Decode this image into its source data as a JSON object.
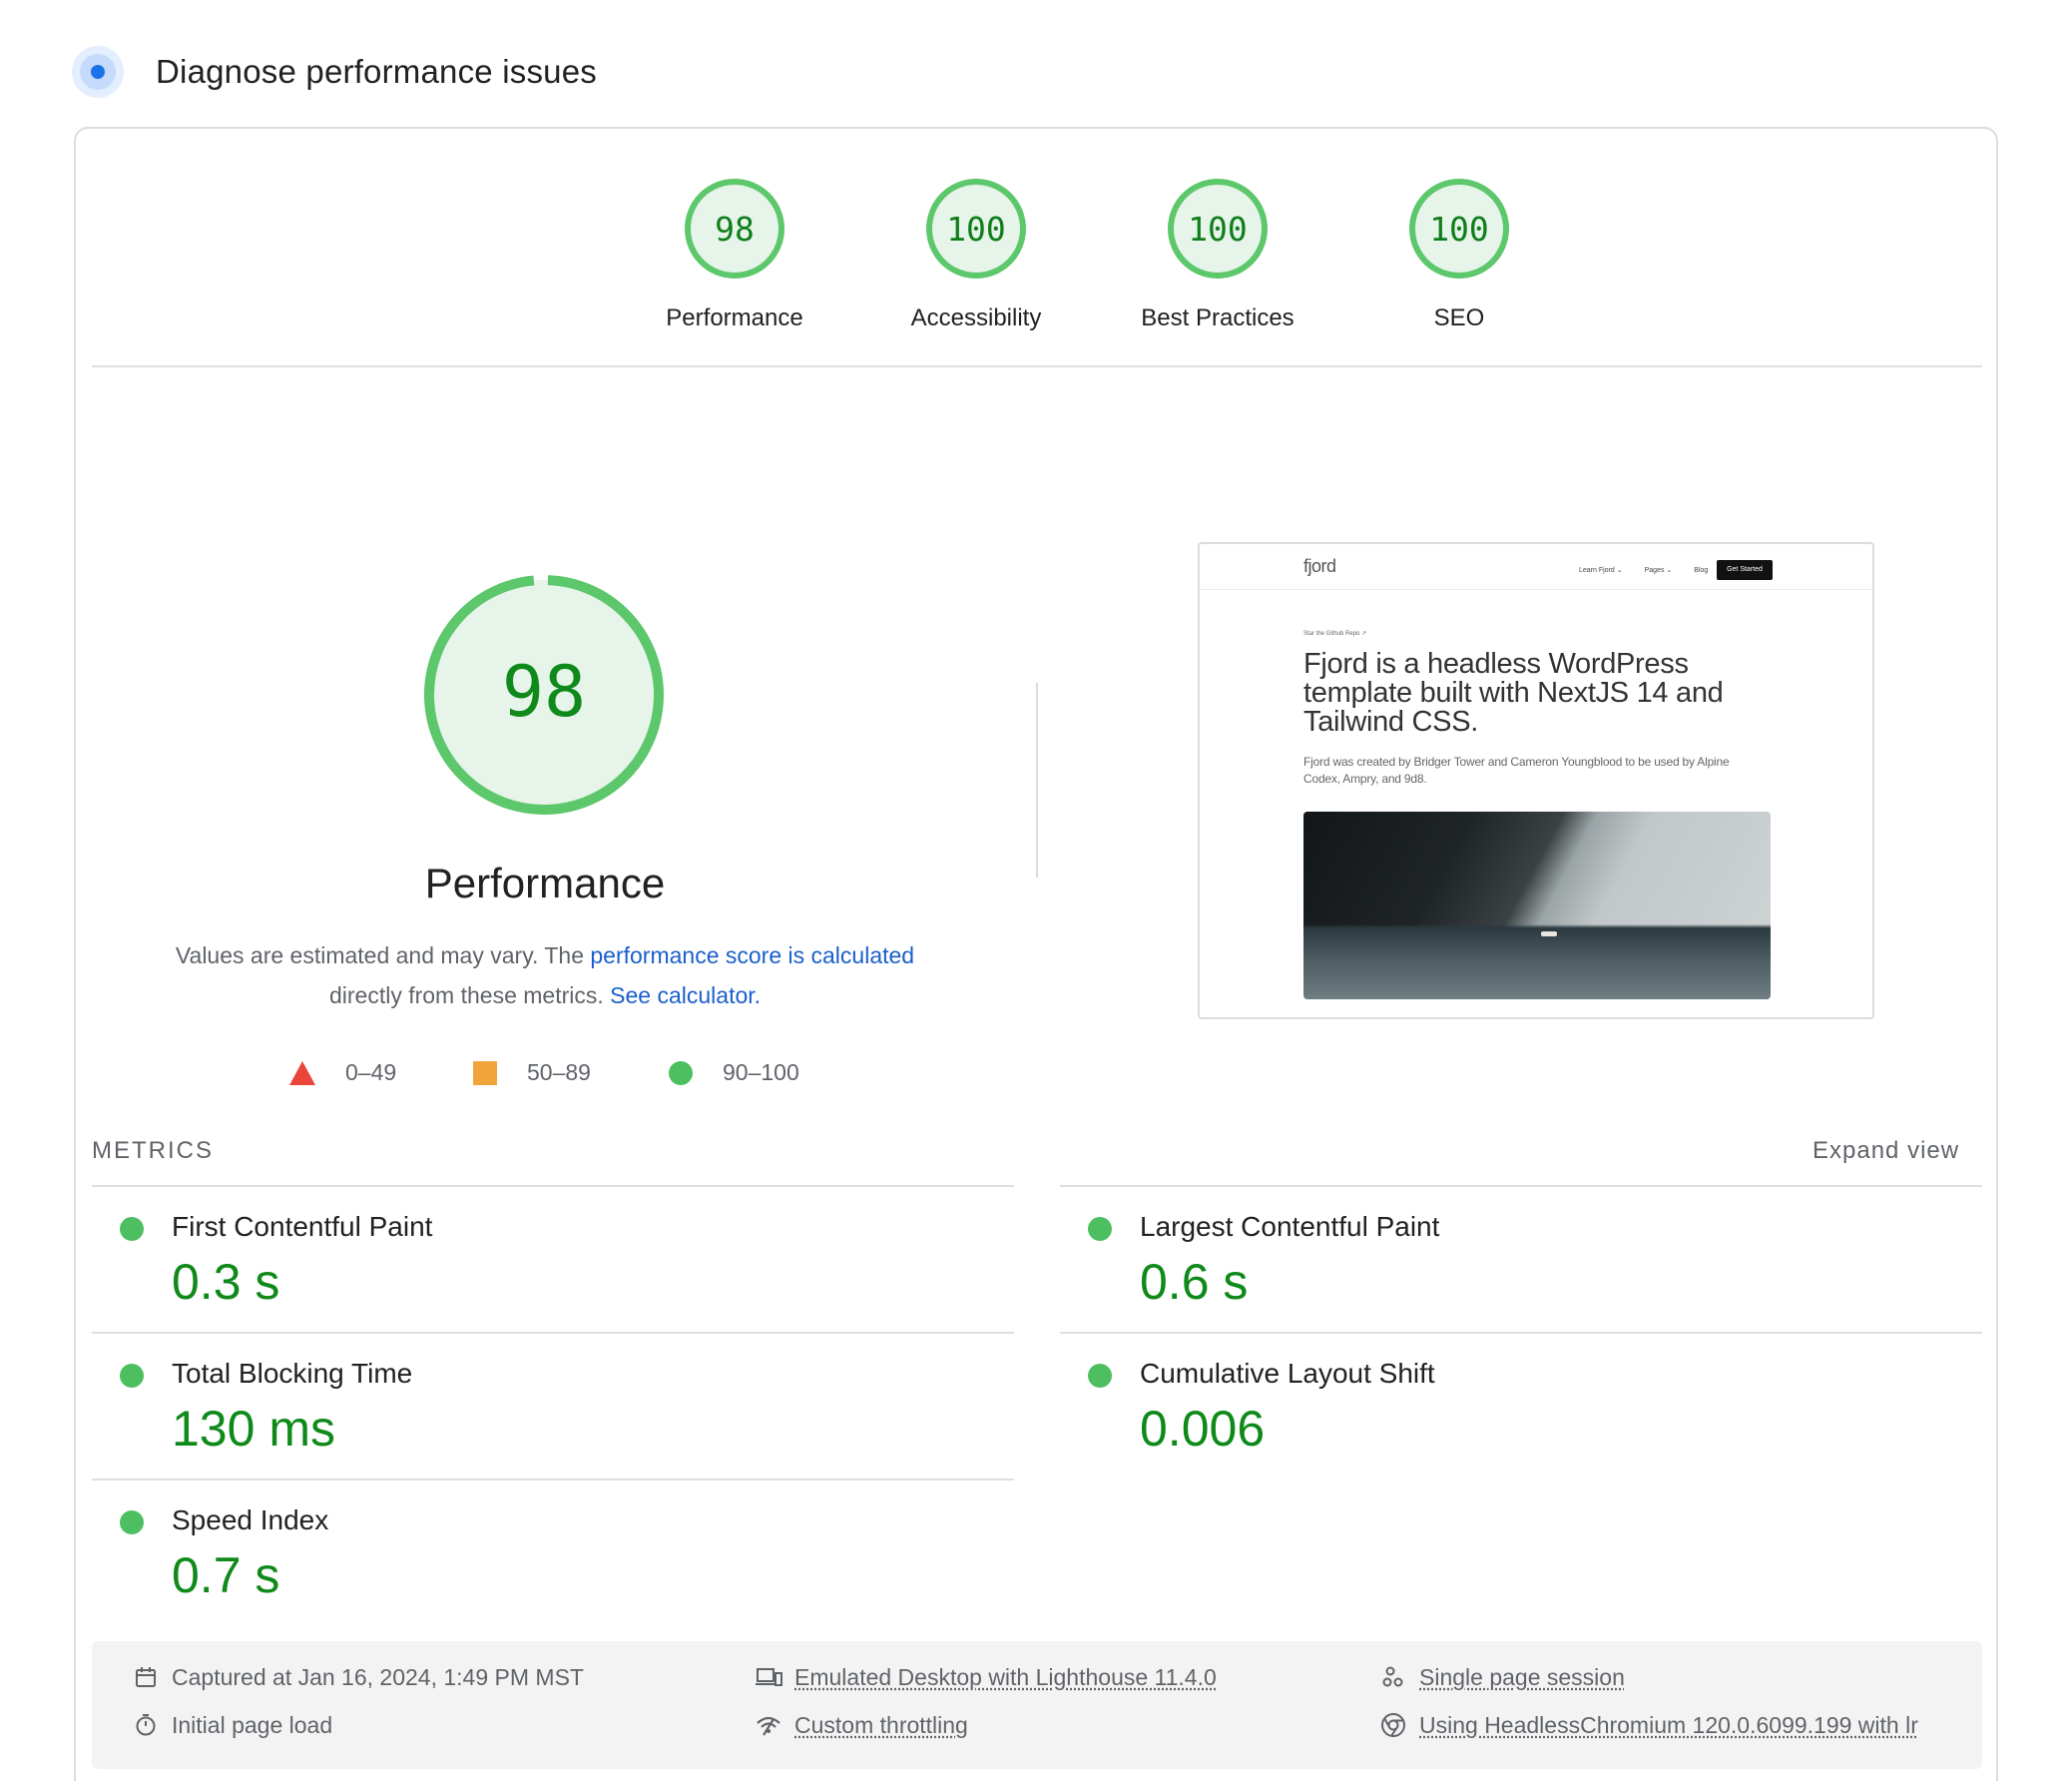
{
  "header": {
    "title": "Diagnose performance issues"
  },
  "categories": [
    {
      "score": "98",
      "label": "Performance"
    },
    {
      "score": "100",
      "label": "Accessibility"
    },
    {
      "score": "100",
      "label": "Best Practices"
    },
    {
      "score": "100",
      "label": "SEO"
    }
  ],
  "performance": {
    "score": "98",
    "score_fraction": 0.98,
    "title": "Performance",
    "desc_prefix": "Values are estimated and may vary. The ",
    "desc_link1": "performance score is calculated",
    "desc_mid": "directly from these metrics. ",
    "desc_link2": "See calculator.",
    "legend": {
      "fail": "0–49",
      "average": "50–89",
      "pass": "90–100"
    }
  },
  "screenshot": {
    "logo": "fjord",
    "nav": [
      "Learn Fjord ⌄",
      "Pages ⌄",
      "Blog"
    ],
    "cta": "Get Started",
    "pill": "Star the Github Repo ↗",
    "headline": "Fjord is a headless WordPress template built with NextJS 14 and Tailwind CSS.",
    "subtext": "Fjord was created by Bridger Tower and Cameron Youngblood to be used by Alpine Codex, Ampry, and 9d8."
  },
  "metrics": {
    "section_label": "METRICS",
    "expand_label": "Expand view",
    "fcp": {
      "name": "First Contentful Paint",
      "value": "0.3 s"
    },
    "lcp": {
      "name": "Largest Contentful Paint",
      "value": "0.6 s"
    },
    "tbt": {
      "name": "Total Blocking Time",
      "value": "130 ms"
    },
    "cls": {
      "name": "Cumulative Layout Shift",
      "value": "0.006"
    },
    "si": {
      "name": "Speed Index",
      "value": "0.7 s"
    }
  },
  "footer": {
    "captured": "Captured at Jan 16, 2024, 1:49 PM MST",
    "load": "Initial page load",
    "device": "Emulated Desktop with Lighthouse 11.4.0",
    "throttling": "Custom throttling",
    "session": "Single page session",
    "browser": "Using HeadlessChromium 120.0.6099.199 with lr"
  },
  "colors": {
    "pass": "#0cce6b",
    "average": "#ffa400",
    "fail": "#ff4e42",
    "link": "#1a73e8"
  }
}
